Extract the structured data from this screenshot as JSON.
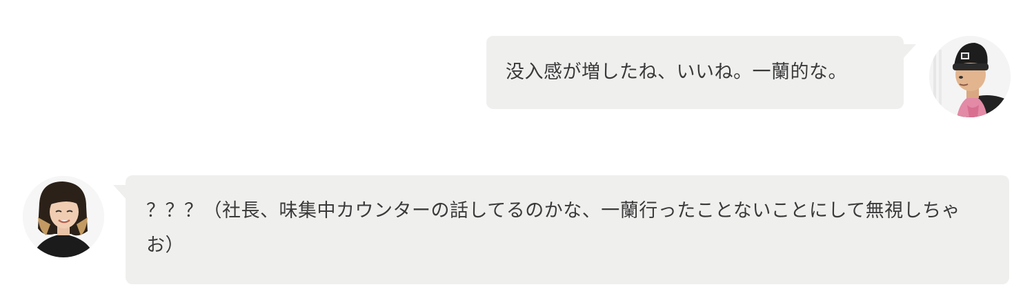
{
  "conversation": {
    "messages": [
      {
        "side": "right",
        "speaker": "man-with-beanie",
        "text": "没入感が増したね、いいね。一蘭的な。"
      },
      {
        "side": "left",
        "speaker": "woman-with-ombre-hair",
        "text": "？？？（社長、味集中カウンターの話してるのかな、一蘭行ったことないことにして無視しちゃお）"
      }
    ]
  },
  "colors": {
    "bubble_bg": "#eff0ee",
    "text": "#3a3a3a",
    "page_bg": "#ffffff"
  }
}
